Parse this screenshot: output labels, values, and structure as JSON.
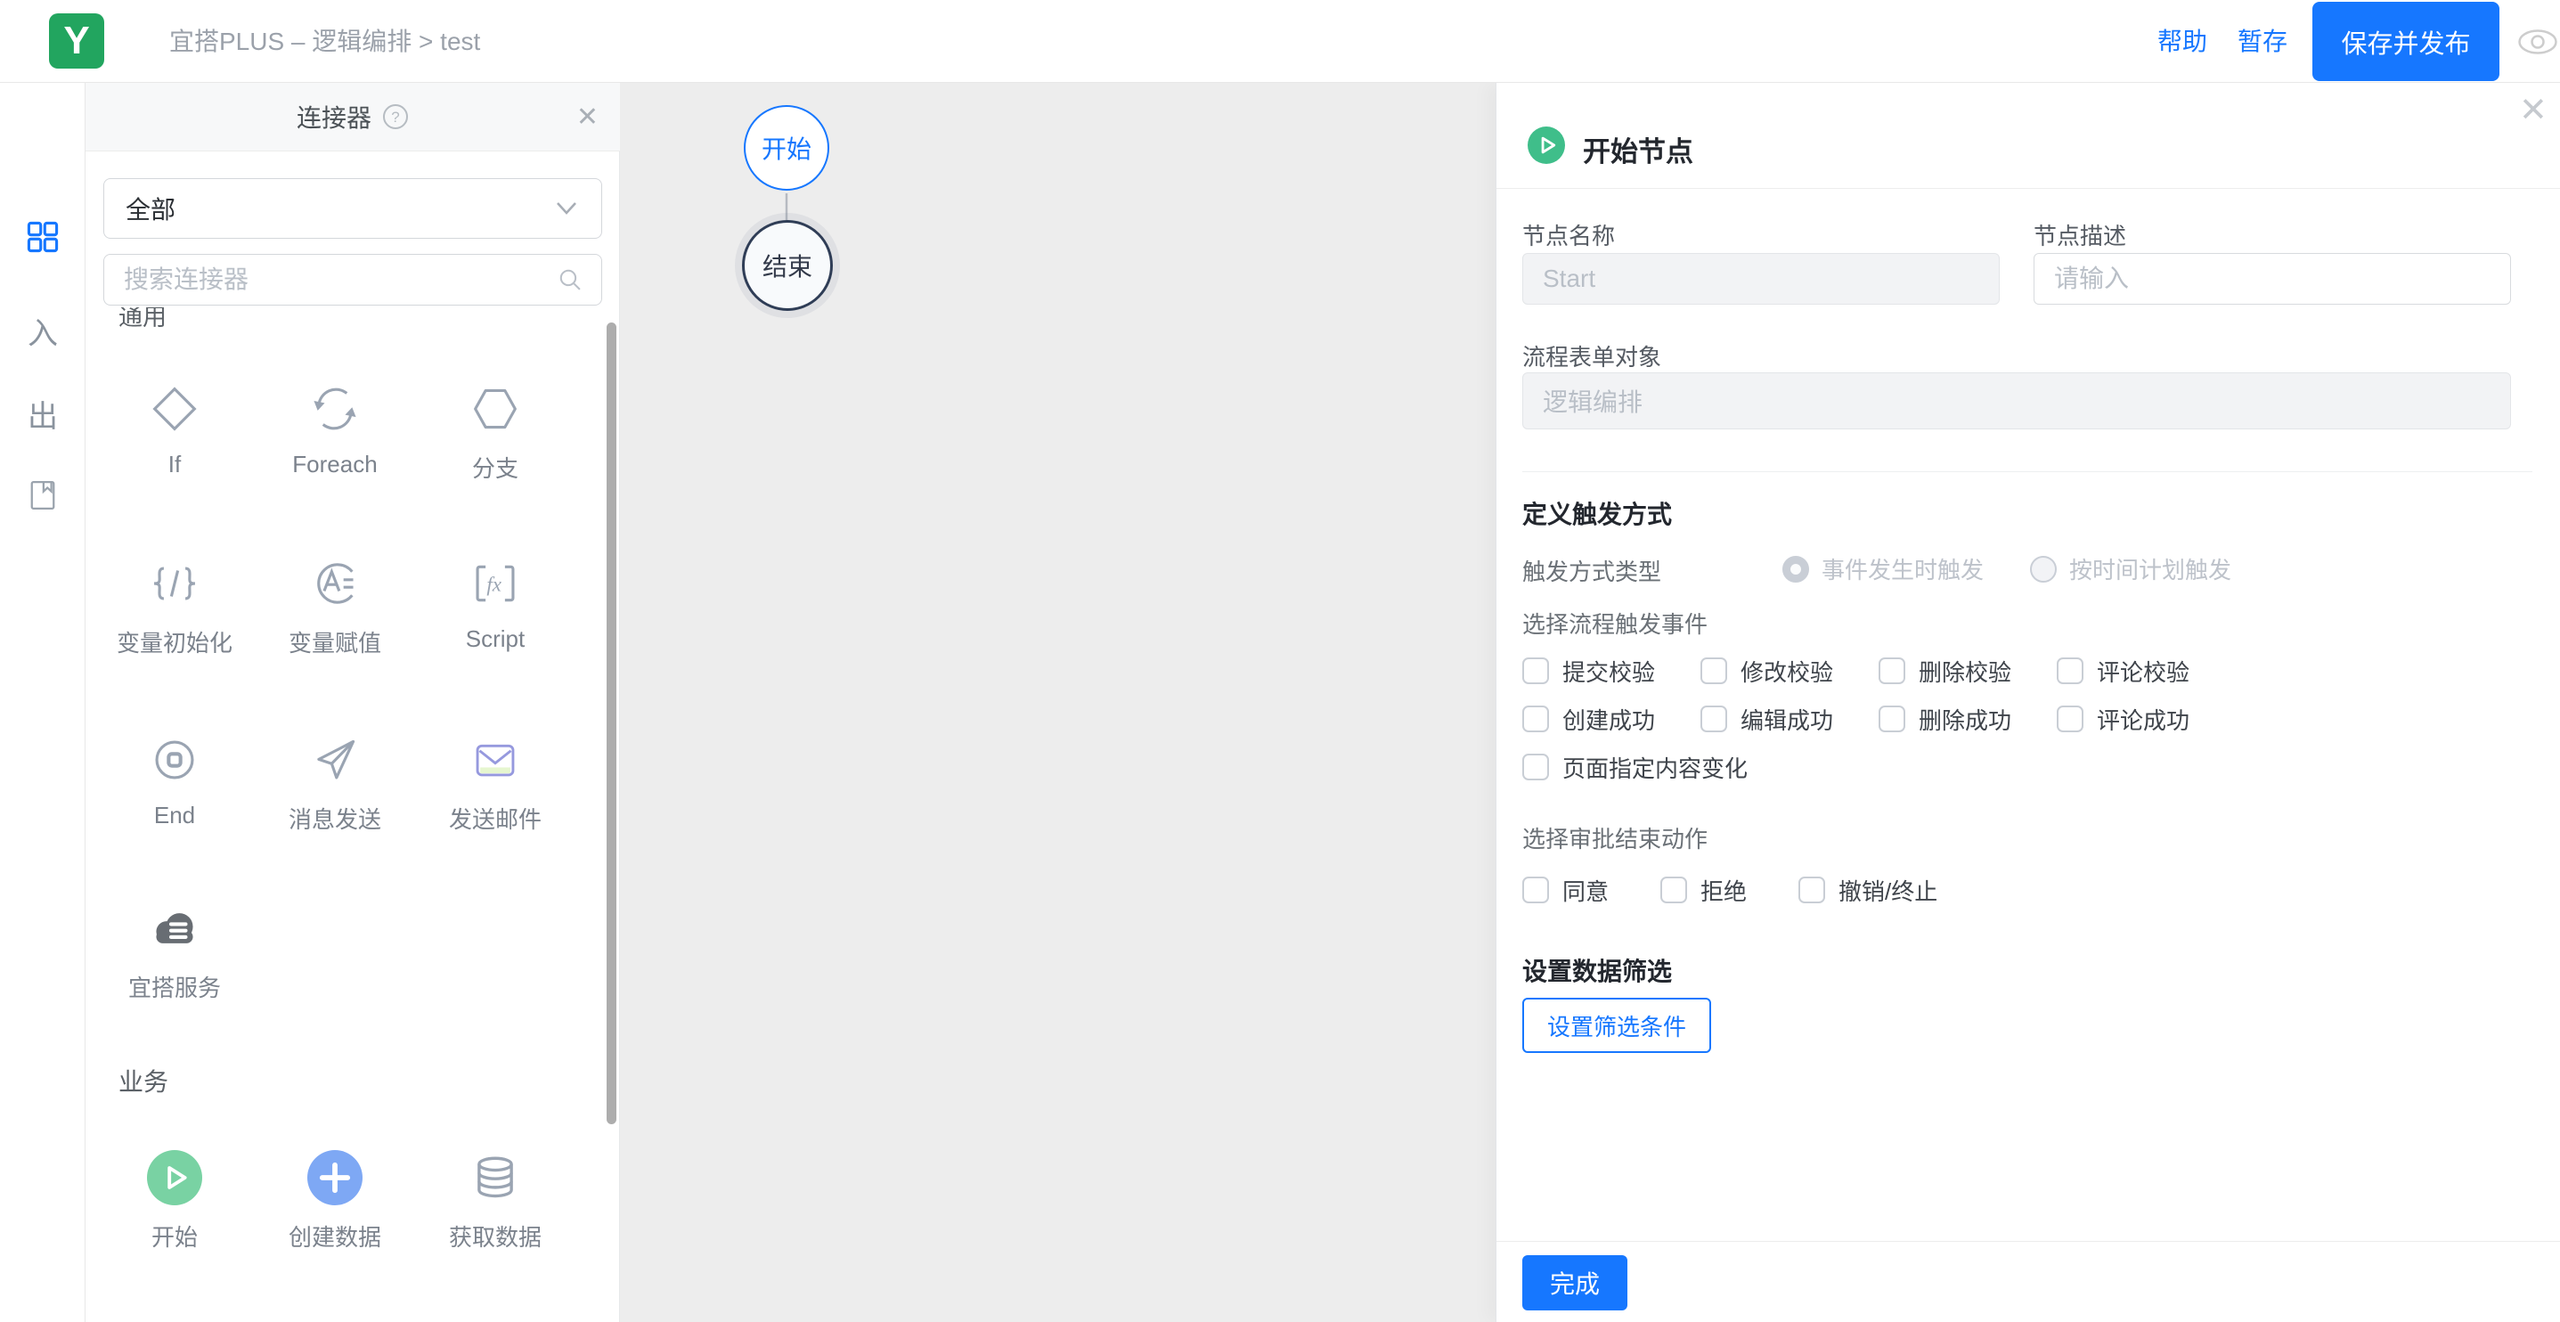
{
  "header": {
    "brand_letter": "Y",
    "breadcrumb": "宜搭PLUS – 逻辑编排 > test",
    "help": "帮助",
    "save_draft": "暂存",
    "publish": "保存并发布"
  },
  "rail": {
    "in_glyph": "入",
    "out_glyph": "出"
  },
  "connector_panel": {
    "title": "连接器",
    "category_value": "全部",
    "search_placeholder": "搜索连接器",
    "clipped_section": "通用",
    "business_section": "业务",
    "general_items": [
      {
        "label": "If"
      },
      {
        "label": "Foreach"
      },
      {
        "label": "分支"
      },
      {
        "label": "变量初始化"
      },
      {
        "label": "变量赋值"
      },
      {
        "label": "Script"
      },
      {
        "label": "End"
      },
      {
        "label": "消息发送"
      },
      {
        "label": "发送邮件"
      },
      {
        "label": "宜搭服务"
      }
    ],
    "business_items": [
      {
        "label": "开始"
      },
      {
        "label": "创建数据"
      },
      {
        "label": "获取数据"
      }
    ]
  },
  "canvas": {
    "start_node": "开始",
    "end_node": "结束"
  },
  "inspector": {
    "title": "开始节点",
    "name_label": "节点名称",
    "name_value": "Start",
    "desc_label": "节点描述",
    "desc_placeholder": "请输入",
    "form_object_label": "流程表单对象",
    "form_object_value": "逻辑编排",
    "trigger_heading": "定义触发方式",
    "trigger_type_label": "触发方式类型",
    "radio_event": "事件发生时触发",
    "radio_schedule": "按时间计划触发",
    "events_label": "选择流程触发事件",
    "event_options": [
      "提交校验",
      "修改校验",
      "删除校验",
      "评论校验",
      "创建成功",
      "编辑成功",
      "删除成功",
      "评论成功",
      "页面指定内容变化"
    ],
    "approval_label": "选择审批结束动作",
    "approval_options": [
      "同意",
      "拒绝",
      "撤销/终止"
    ],
    "filter_heading": "设置数据筛选",
    "filter_button": "设置筛选条件",
    "done_button": "完成"
  },
  "colors": {
    "primary_blue": "#1677ff",
    "brand_green": "#22a55f",
    "canvas_gray": "#ededed"
  }
}
